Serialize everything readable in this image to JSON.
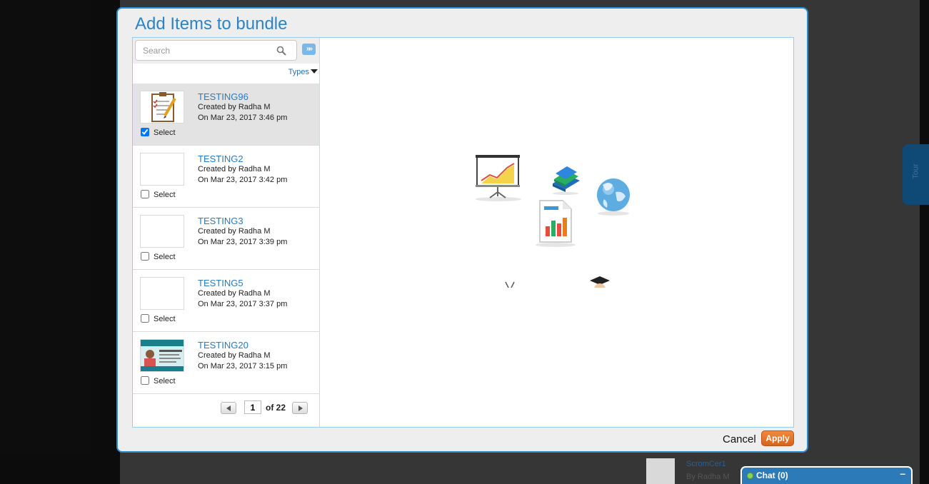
{
  "modal": {
    "title": "Add Items to bundle",
    "cancel_label": "Cancel",
    "apply_label": "Apply"
  },
  "search": {
    "placeholder": "Search"
  },
  "filter": {
    "types_label": "Types"
  },
  "items": [
    {
      "title": "TESTING96",
      "created_by": "Created by Radha M",
      "date": "On Mar 23, 2017 3:46 pm",
      "select_label": "Select",
      "checked": true,
      "thumb": "checklist-pencil"
    },
    {
      "title": "TESTING2",
      "created_by": "Created by Radha M",
      "date": "On Mar 23, 2017 3:42 pm",
      "select_label": "Select",
      "checked": false,
      "thumb": "blank"
    },
    {
      "title": "TESTING3",
      "created_by": "Created by Radha M",
      "date": "On Mar 23, 2017 3:39 pm",
      "select_label": "Select",
      "checked": false,
      "thumb": "blank"
    },
    {
      "title": "TESTING5",
      "created_by": "Created by Radha M",
      "date": "On Mar 23, 2017 3:37 pm",
      "select_label": "Select",
      "checked": false,
      "thumb": "blank"
    },
    {
      "title": "TESTING20",
      "created_by": "Created by Radha M",
      "date": "On Mar 23, 2017 3:15 pm",
      "select_label": "Select",
      "checked": false,
      "thumb": "tutorial-banner"
    }
  ],
  "pager": {
    "current_page": "1",
    "of_label": "of 22"
  },
  "background": {
    "item_title": "ScromCer1",
    "item_by": "By Radha M",
    "tour_label": "Tour"
  },
  "chat": {
    "label": "Chat  (0)",
    "minimize": "–"
  },
  "colors": {
    "accent": "#2a84c6",
    "apply": "#e2742b",
    "chat": "#2c7ab8"
  }
}
